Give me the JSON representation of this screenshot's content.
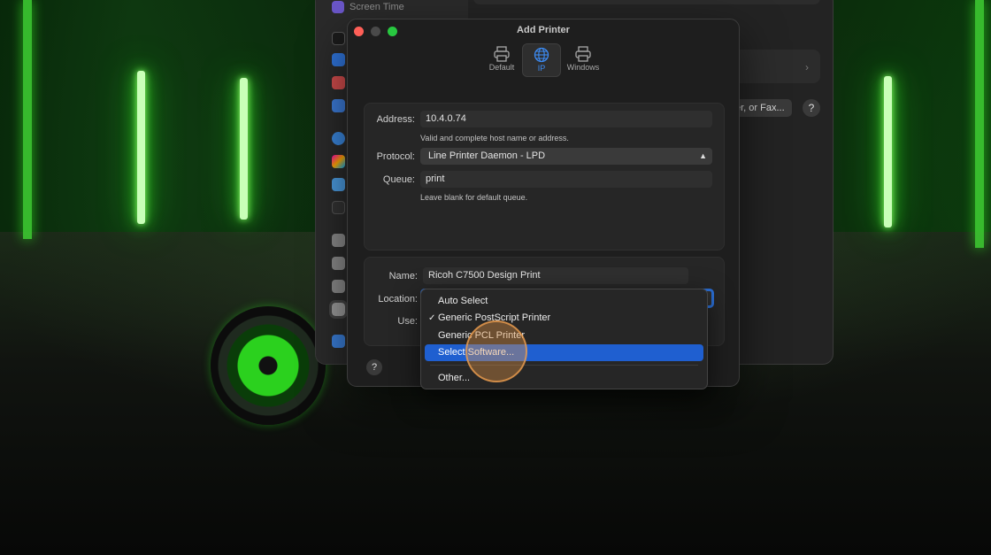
{
  "colors": {
    "accent": "#2b6fd6",
    "menu_highlight": "#1f5fd0",
    "close": "#fe5f57",
    "minimize": "#4a4a4a",
    "zoom": "#28c840",
    "neon_green": "#3cf02a",
    "click_indicator": "#e6964a"
  },
  "settings_window": {
    "sidebar_top_item": "Screen Time",
    "sidebar_top_icon": "hourglass-icon",
    "sidebar_icons": [
      "lock-icon",
      "hand-icon",
      "game-controller-icon",
      "family-icon",
      "internet-accounts-icon",
      "game-center-icon",
      "icloud-icon",
      "wallet-icon",
      "keyboard-icon",
      "mouse-icon",
      "game-controllers-icon",
      "printers-icon",
      "migration-icon"
    ],
    "add_button_label": "er, or Fax...",
    "help_label": "?",
    "chevron": "›"
  },
  "dialog": {
    "title": "Add Printer",
    "toolbar": [
      {
        "label": "Default",
        "icon": "printer-icon"
      },
      {
        "label": "IP",
        "icon": "globe-icon"
      },
      {
        "label": "Windows",
        "icon": "windows-printer-icon"
      }
    ],
    "address": {
      "label": "Address:",
      "value": "10.4.0.74",
      "hint": "Valid and complete host name or address."
    },
    "protocol": {
      "label": "Protocol:",
      "value": "Line Printer Daemon - LPD"
    },
    "queue": {
      "label": "Queue:",
      "value": "print",
      "hint": "Leave blank for default queue."
    },
    "name": {
      "label": "Name:",
      "value": "Ricoh C7500 Design Print"
    },
    "location": {
      "label": "Location:"
    },
    "use": {
      "label": "Use:"
    },
    "help_label": "?"
  },
  "use_menu": {
    "items": [
      {
        "label": "Auto Select",
        "checked": false
      },
      {
        "label": "Generic PostScript Printer",
        "checked": true
      },
      {
        "label": "Generic PCL Printer",
        "checked": false
      },
      {
        "label": "Select Software...",
        "checked": false,
        "highlighted": true
      },
      {
        "label": "Other...",
        "checked": false
      }
    ],
    "check_glyph": "✓"
  }
}
